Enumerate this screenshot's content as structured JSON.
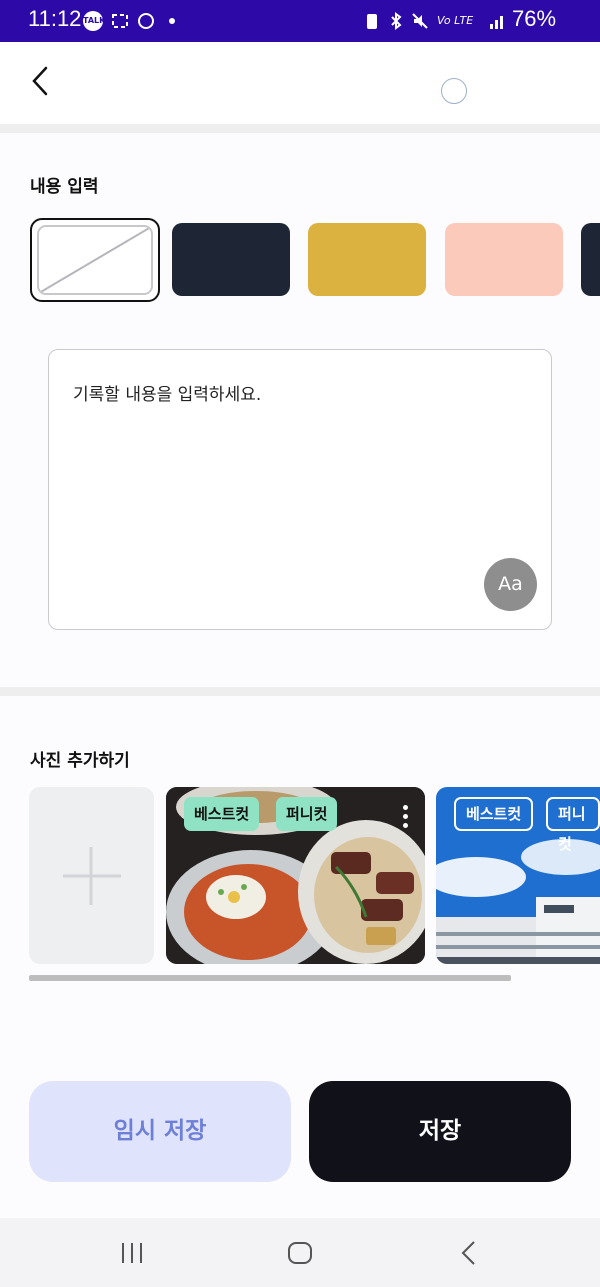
{
  "status_bar": {
    "time": "11:12",
    "talk_label": "TALK",
    "network": "Vo LTE",
    "battery": "76%"
  },
  "header": {
    "back_icon": "chevron-left-icon",
    "loading_icon": "circle-icon"
  },
  "content_section": {
    "title": "내용 입력",
    "swatches": [
      {
        "name": "none",
        "color": "none"
      },
      {
        "name": "navy",
        "color": "#1e2535"
      },
      {
        "name": "mustard",
        "color": "#dbb13f"
      },
      {
        "name": "peach",
        "color": "#fbcabb"
      },
      {
        "name": "navy-2",
        "color": "#1e2535"
      }
    ],
    "memo_placeholder": "기록할 내용을 입력하세요.",
    "font_button": "Aa"
  },
  "photo_section": {
    "title": "사진 추가하기",
    "photos": [
      {
        "tags": [
          "베스트컷",
          "퍼니컷"
        ]
      },
      {
        "tags": [
          "베스트컷",
          "퍼니컷"
        ]
      }
    ]
  },
  "actions": {
    "temp_save": "임시 저장",
    "save": "저장"
  },
  "colors": {
    "accent": "#2d0aa8",
    "tag_green": "#8fe3c4",
    "temp_save_bg": "#dfe4fc",
    "save_bg": "#111219"
  }
}
